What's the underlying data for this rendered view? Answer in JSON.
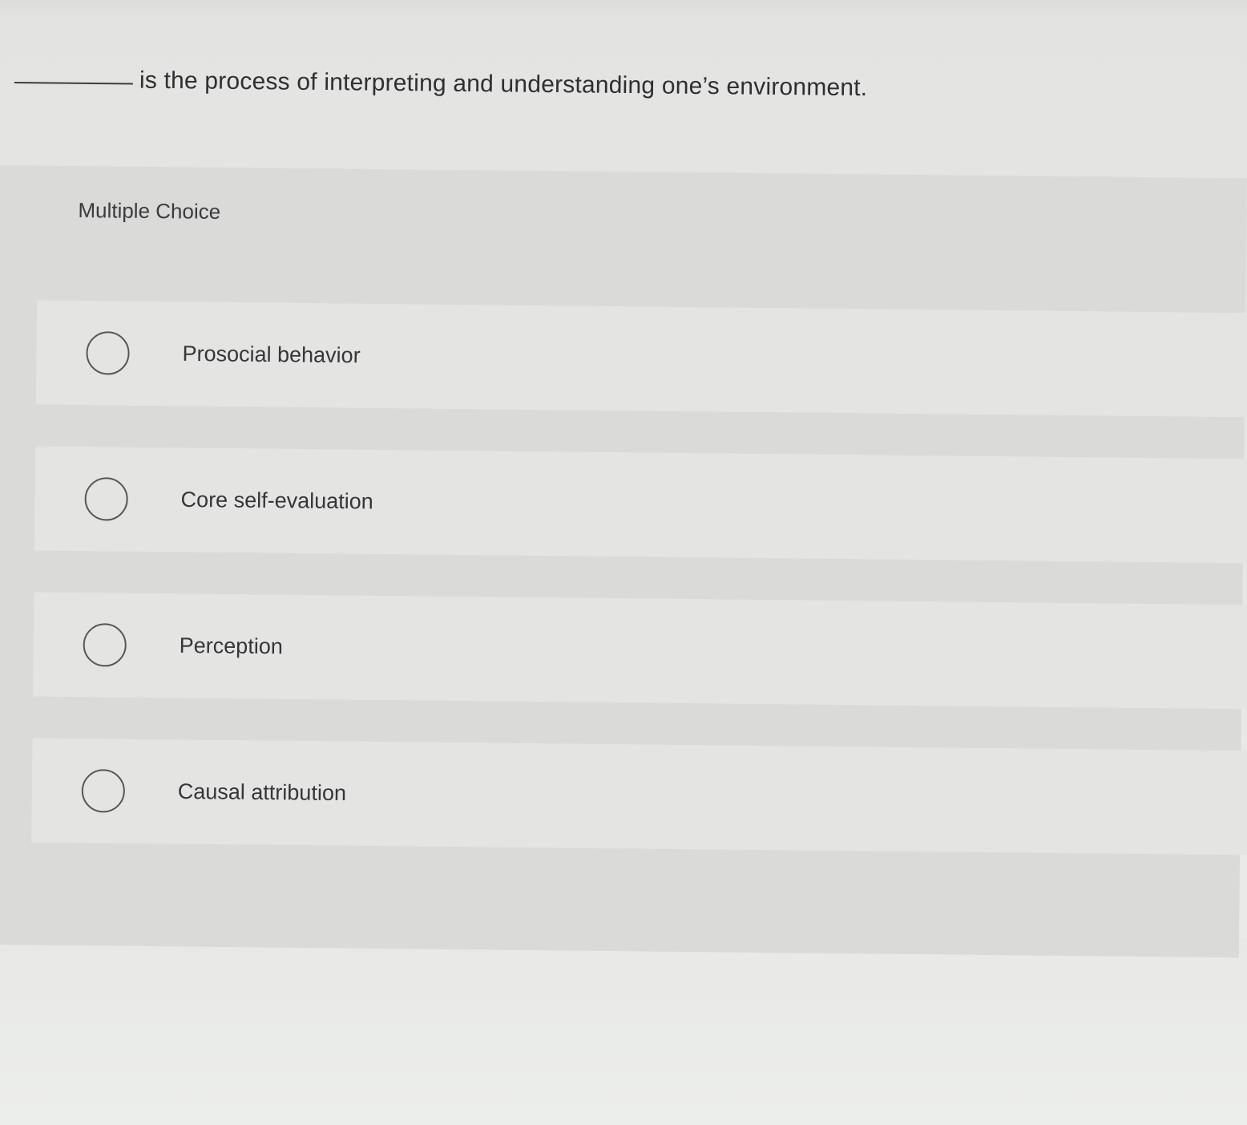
{
  "question": {
    "text": "is the process of interpreting and understanding one’s environment."
  },
  "section": {
    "header": "Multiple Choice"
  },
  "options": [
    {
      "label": "Prosocial behavior",
      "selected": false
    },
    {
      "label": "Core self-evaluation",
      "selected": false
    },
    {
      "label": "Perception",
      "selected": false
    },
    {
      "label": "Causal attribution",
      "selected": false
    }
  ]
}
